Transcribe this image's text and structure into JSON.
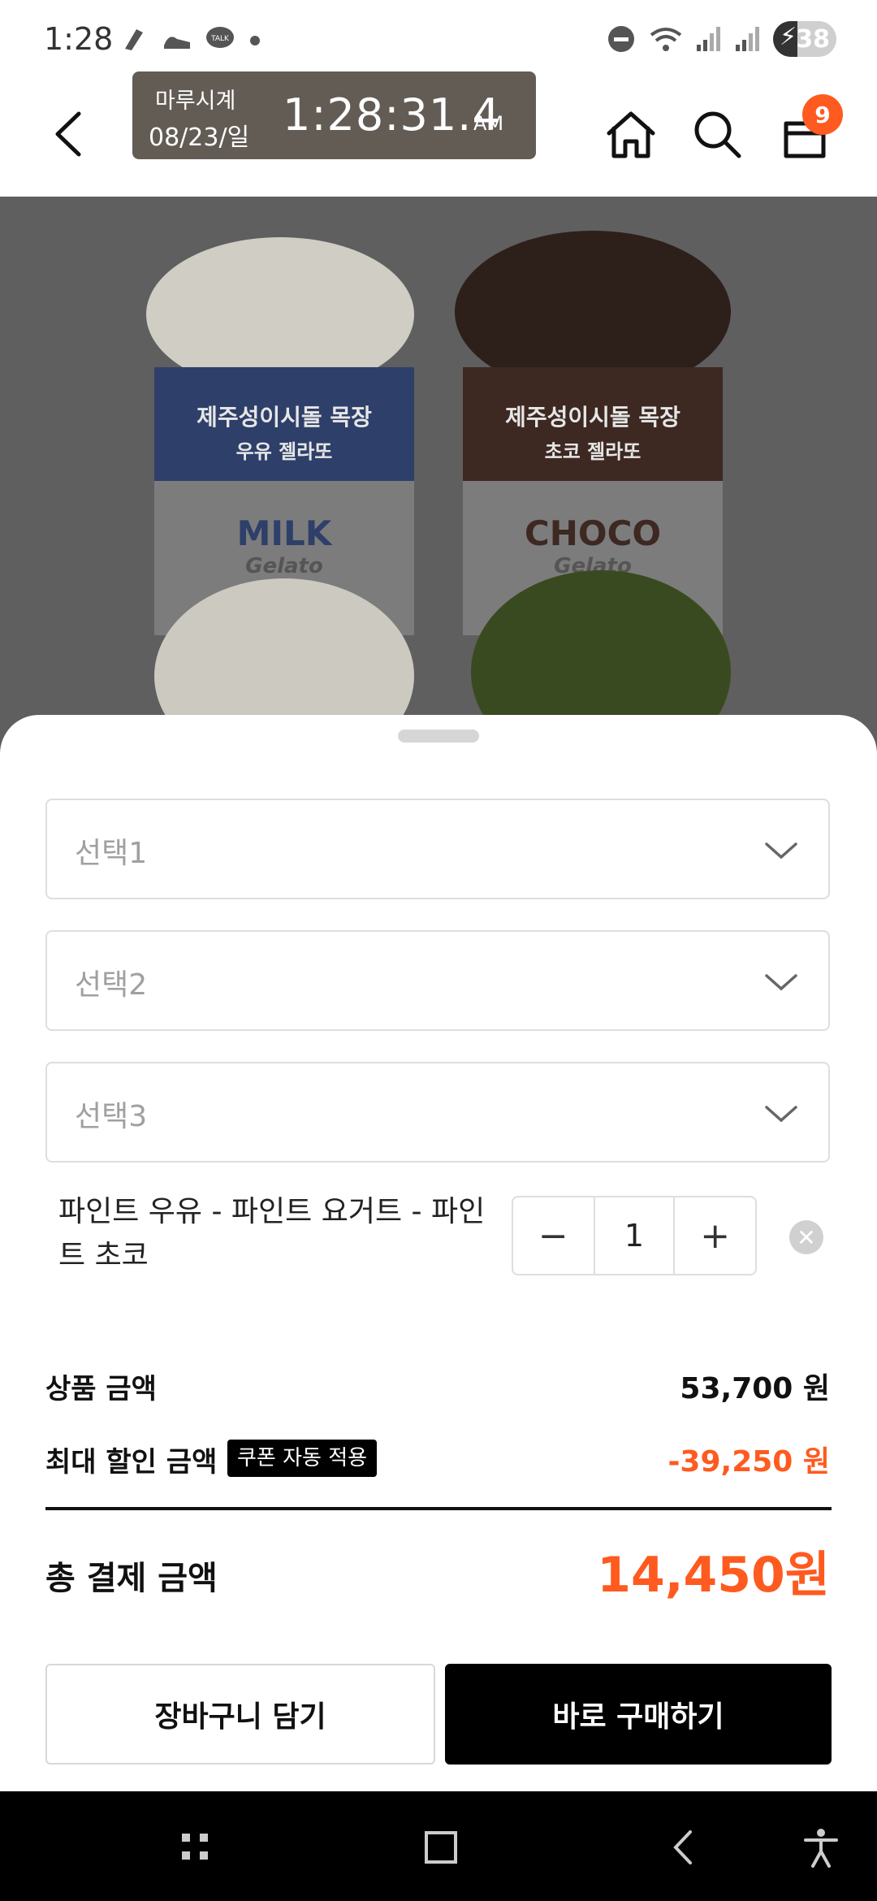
{
  "status_bar": {
    "time": "1:28",
    "battery": "38",
    "icons": [
      "pen-icon",
      "shoe-icon",
      "talk-icon",
      "dot-icon",
      "dnd-icon",
      "wifi-icon",
      "signal-icon",
      "signal-icon",
      "battery-icon"
    ]
  },
  "header": {
    "clock_name": "마루시계",
    "clock_date": "08/23/일",
    "clock_time": "1:28:31.4",
    "clock_ampm": "AM",
    "cart_count": "9"
  },
  "product": {
    "left_cup": {
      "brand": "제주성이시돌 목장",
      "sub": "우유 젤라또",
      "name": "MILK",
      "script": "Gelato"
    },
    "right_cup": {
      "brand": "제주성이시돌 목장",
      "sub": "초코 젤라또",
      "name": "CHOCO",
      "script": "Gelato"
    }
  },
  "options": {
    "select1": "선택1",
    "select2": "선택2",
    "select3": "선택3",
    "selected_item": "파인트 우유 - 파인트 요거트 - 파인트 초코",
    "quantity": "1",
    "minus": "−",
    "plus": "+"
  },
  "summary": {
    "product_price_label": "상품 금액",
    "product_price": "53,700 원",
    "discount_label": "최대 할인 금액",
    "coupon_badge": "쿠폰 자동 적용",
    "discount": "-39,250 원",
    "total_label": "총 결제 금액",
    "total": "14,450원"
  },
  "buttons": {
    "cart": "장바구니 담기",
    "buy": "바로 구매하기"
  },
  "colors": {
    "accent": "#ff5a1f",
    "clock_bg": "#625c55",
    "overlay": "#5f5f5f"
  }
}
